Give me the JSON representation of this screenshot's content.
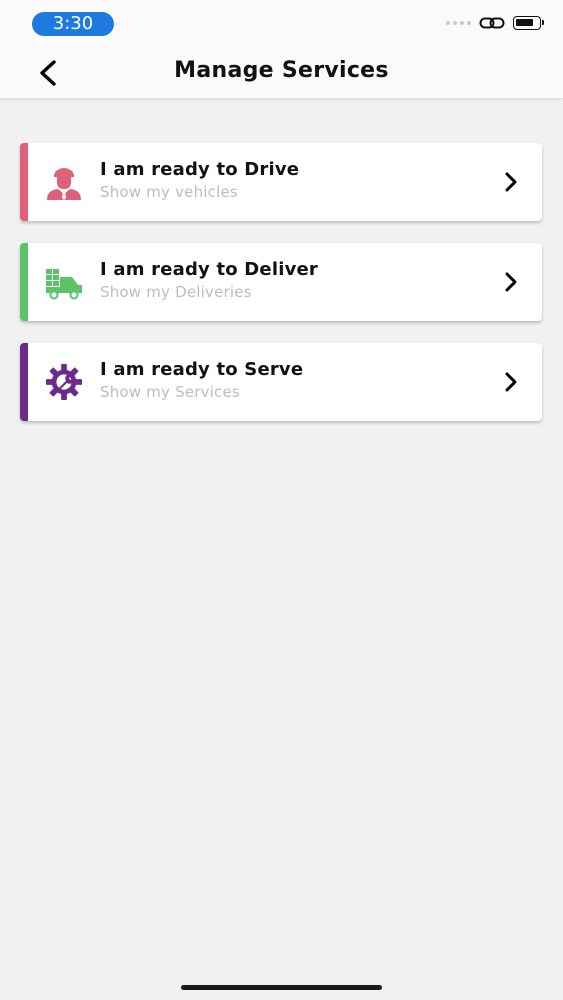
{
  "status_bar": {
    "time": "3:30"
  },
  "nav": {
    "title": "Manage Services",
    "back_icon": "chevron-left-icon"
  },
  "services": [
    {
      "title": "I am ready to Drive",
      "subtitle": "Show my vehicles",
      "icon": "driver-icon",
      "accent": "#e0607a"
    },
    {
      "title": "I am ready to Deliver",
      "subtitle": "Show my Deliveries",
      "icon": "delivery-truck-icon",
      "accent": "#5cc466"
    },
    {
      "title": "I am ready to Serve",
      "subtitle": "Show my Services",
      "icon": "service-gear-icon",
      "accent": "#6b2a8c"
    }
  ],
  "colors": {
    "background": "#f1f1f3",
    "time_pill": "#1f7ae0"
  }
}
